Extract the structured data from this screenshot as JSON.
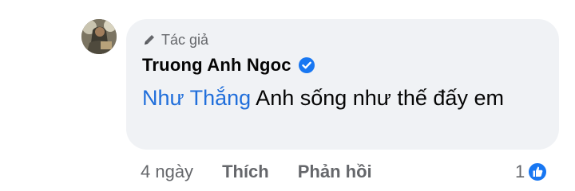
{
  "comment": {
    "author_badge": "Tác giả",
    "author_name": "Truong Anh Ngoc",
    "mention": "Như Thắng",
    "text": " Anh sống như thế đấy em"
  },
  "actions": {
    "time": "4 ngày",
    "like_label": "Thích",
    "reply_label": "Phản hồi"
  },
  "reactions": {
    "count": "1"
  },
  "icons": {
    "badge": "pencil-icon",
    "verified": "verified-icon",
    "reaction": "like-reaction-icon"
  },
  "colors": {
    "bubble": "#f0f2f5",
    "mention": "#216fdb",
    "verified": "#1877f2",
    "secondary_text": "#65676b"
  }
}
